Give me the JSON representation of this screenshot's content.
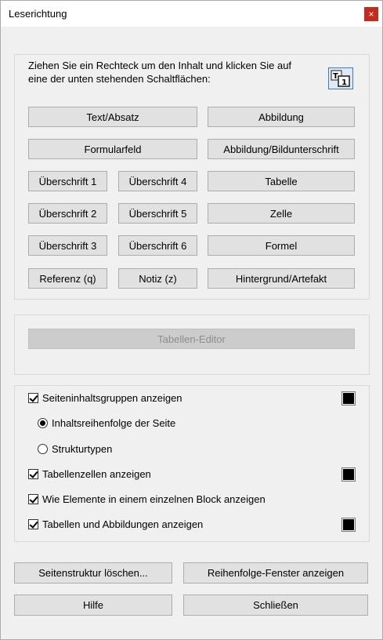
{
  "window": {
    "title": "Leserichtung",
    "close_icon": "×"
  },
  "instructions": {
    "line1": "Ziehen Sie ein Rechteck um den Inhalt und klicken Sie auf",
    "line2": "eine der unten stehenden Schaltflächen:"
  },
  "tag_buttons": {
    "text": "Text/Absatz",
    "figure": "Abbildung",
    "form_field": "Formularfeld",
    "figure_caption": "Abbildung/Bildunterschrift",
    "heading1": "Überschrift 1",
    "heading4": "Überschrift 4",
    "table": "Tabelle",
    "heading2": "Überschrift 2",
    "heading5": "Überschrift 5",
    "cell": "Zelle",
    "heading3": "Überschrift 3",
    "heading6": "Überschrift 6",
    "formula": "Formel",
    "reference": "Referenz (q)",
    "note": "Notiz (z)",
    "background": "Hintergrund/Artefakt"
  },
  "table_editor": {
    "label": "Tabellen-Editor",
    "enabled": false
  },
  "display_options": {
    "show_content_groups": {
      "label": "Seiteninhaltsgruppen anzeigen",
      "checked": true,
      "color": "#000000"
    },
    "page_content_order": {
      "label": "Inhaltsreihenfolge der Seite",
      "selected": true
    },
    "structure_types": {
      "label": "Strukturtypen",
      "selected": false
    },
    "show_table_cells": {
      "label": "Tabellenzellen anzeigen",
      "checked": true,
      "color": "#000000"
    },
    "show_as_single_block": {
      "label": "Wie Elemente in einem einzelnen Block anzeigen",
      "checked": true
    },
    "show_tables_figures": {
      "label": "Tabellen und Abbildungen anzeigen",
      "checked": true,
      "color": "#000000"
    }
  },
  "footer": {
    "clear_structure": "Seitenstruktur löschen...",
    "show_order_panel": "Reihenfolge-Fenster anzeigen",
    "help": "Hilfe",
    "close": "Schließen"
  }
}
